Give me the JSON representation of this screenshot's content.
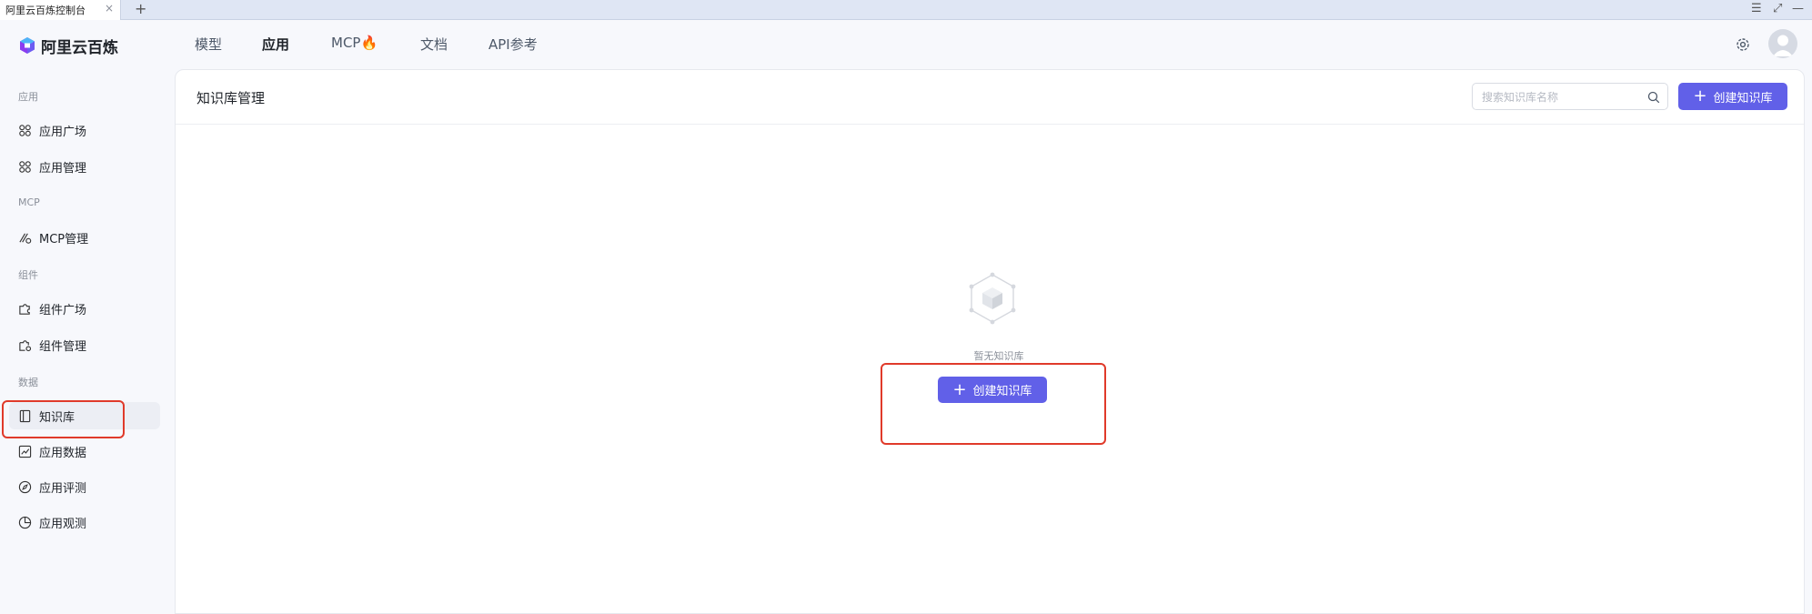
{
  "browser": {
    "tab_title": "阿里云百炼控制台",
    "tab_close": "×",
    "new_tab": "+",
    "window_controls": {
      "menu": "☰",
      "maximize": "⤢",
      "minimize": "—"
    }
  },
  "topnav": {
    "brand": "阿里云百炼",
    "items": [
      {
        "label": "模型"
      },
      {
        "label": "应用",
        "active": true
      },
      {
        "label": "MCP🔥"
      },
      {
        "label": "文档"
      },
      {
        "label": "API参考"
      }
    ],
    "icons": [
      "gear-icon",
      "avatar"
    ]
  },
  "sidebar": {
    "sections": [
      {
        "label": "应用",
        "items": [
          {
            "label": "应用广场",
            "icon": "apps-icon"
          },
          {
            "label": "应用管理",
            "icon": "apps-icon"
          }
        ]
      },
      {
        "label": "MCP",
        "items": [
          {
            "label": "MCP管理",
            "icon": "mcp-icon"
          }
        ]
      },
      {
        "label": "组件",
        "items": [
          {
            "label": "组件广场",
            "icon": "puzzle-icon"
          },
          {
            "label": "组件管理",
            "icon": "puzzle-gear-icon"
          }
        ]
      },
      {
        "label": "数据",
        "items": [
          {
            "label": "知识库",
            "icon": "book-icon",
            "active": true
          },
          {
            "label": "应用数据",
            "icon": "chart-icon"
          },
          {
            "label": "应用评测",
            "icon": "compass-icon"
          },
          {
            "label": "应用观测",
            "icon": "pie-icon"
          }
        ]
      }
    ]
  },
  "main": {
    "title": "知识库管理",
    "search_placeholder": "搜索知识库名称",
    "create_button": "创建知识库",
    "empty_text": "暂无知识库",
    "empty_create_button": "创建知识库"
  },
  "colors": {
    "primary": "#6160e8",
    "highlight": "#e03a2a",
    "background": "#f7f8fc"
  }
}
